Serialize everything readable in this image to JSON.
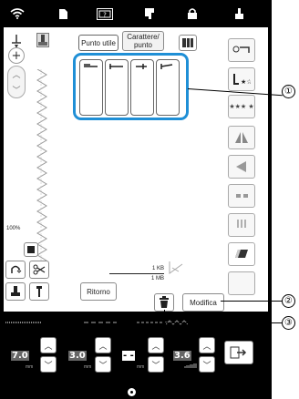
{
  "toolbar": {
    "icons": [
      "wifi-icon",
      "page-icon",
      "help-icon",
      "needle-threader-icon",
      "lock-icon",
      "presser-foot-icon"
    ]
  },
  "buttons": {
    "punto_utile": "Punto utile",
    "carattere_punto": "Carattere/\npunto",
    "ritorno": "Ritorno",
    "modifica": "Modifica"
  },
  "status": {
    "zoom": "100%",
    "memory_used": "1 KB",
    "memory_total": "1 MB"
  },
  "settings": {
    "width": "7.0",
    "length": "3.0",
    "tension_placeholder": "- -",
    "tension": "3.6",
    "unit_mm": "mm"
  },
  "callouts": [
    "①",
    "②",
    "③"
  ],
  "colors": {
    "accent": "#1f8fd6",
    "background": "#000000"
  }
}
